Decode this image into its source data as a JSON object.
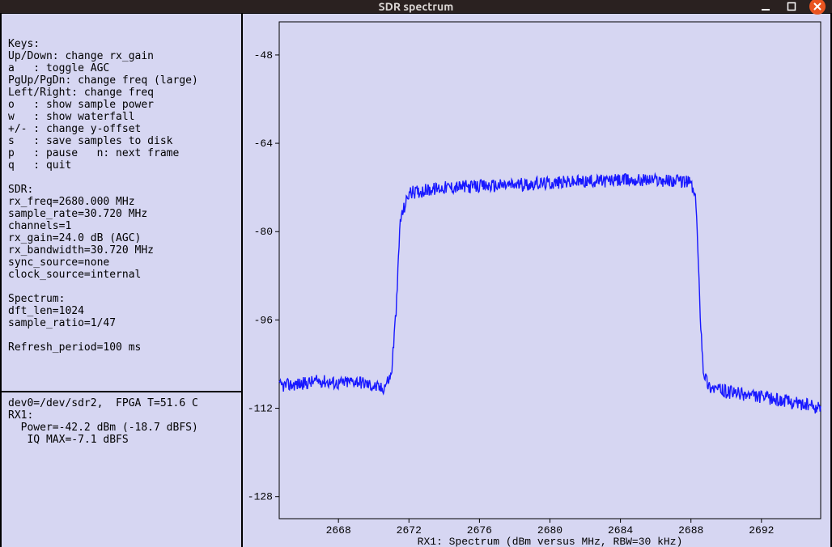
{
  "titlebar": {
    "title": "SDR spectrum"
  },
  "keys": {
    "heading": "Keys:",
    "updown": "Up/Down: change rx_gain",
    "a": "a   : toggle AGC",
    "pg": "PgUp/PgDn: change freq (large)",
    "lr": "Left/Right: change freq",
    "o": "o   : show sample power",
    "w": "w   : show waterfall",
    "pm": "+/- : change y-offset",
    "s": "s   : save samples to disk",
    "p": "p   : pause   n: next frame",
    "q": "q   : quit"
  },
  "sdr": {
    "heading": "SDR:",
    "rx_freq": "rx_freq=2680.000 MHz",
    "sample_rate": "sample_rate=30.720 MHz",
    "channels": "channels=1",
    "rx_gain": "rx_gain=24.0 dB (AGC)",
    "rx_bw": "rx_bandwidth=30.720 MHz",
    "sync": "sync_source=none",
    "clock": "clock_source=internal"
  },
  "spectrum": {
    "heading": "Spectrum:",
    "dft": "dft_len=1024",
    "ratio": "sample_ratio=1/47"
  },
  "refresh": "Refresh_period=100 ms",
  "status": {
    "dev": "dev0=/dev/sdr2,  FPGA T=51.6 C",
    "rx": "RX1:",
    "power": "  Power=-42.2 dBm (-18.7 dBFS)",
    "iq": "   IQ MAX=-7.1 dBFS"
  },
  "chart_data": {
    "type": "line",
    "title": "RX1: Spectrum (dBm versus MHz, RBW=30 kHz)",
    "xlabel": "RX1: Spectrum (dBm versus MHz, RBW=30 kHz)",
    "ylabel": "",
    "xlim": [
      2664.64,
      2695.36
    ],
    "ylim": [
      -132,
      -42
    ],
    "xticks": [
      2668,
      2672,
      2676,
      2680,
      2684,
      2688,
      2692
    ],
    "yticks": [
      -128,
      -112,
      -96,
      -80,
      -64,
      -48
    ],
    "series": [
      {
        "name": "RX1",
        "color": "#1818ff",
        "x": [
          2664.64,
          2666,
          2667,
          2668,
          2669,
          2670,
          2670.5,
          2671,
          2671.3,
          2671.5,
          2672,
          2673,
          2674,
          2676,
          2678,
          2680,
          2682,
          2684,
          2686,
          2687,
          2688,
          2688.3,
          2688.5,
          2688.7,
          2689,
          2689.5,
          2690,
          2691,
          2692,
          2693,
          2694,
          2695.36
        ],
        "y": [
          -108,
          -107.5,
          -107,
          -107.5,
          -107,
          -108,
          -108.5,
          -106,
          -93,
          -78,
          -73,
          -72.5,
          -72,
          -71.8,
          -71.5,
          -71.2,
          -70.9,
          -70.7,
          -70.6,
          -70.8,
          -71,
          -75,
          -93,
          -105,
          -108,
          -108.5,
          -109,
          -109.5,
          -110,
          -110.5,
          -111,
          -112
        ]
      }
    ],
    "noise_amplitude": 1.2
  }
}
